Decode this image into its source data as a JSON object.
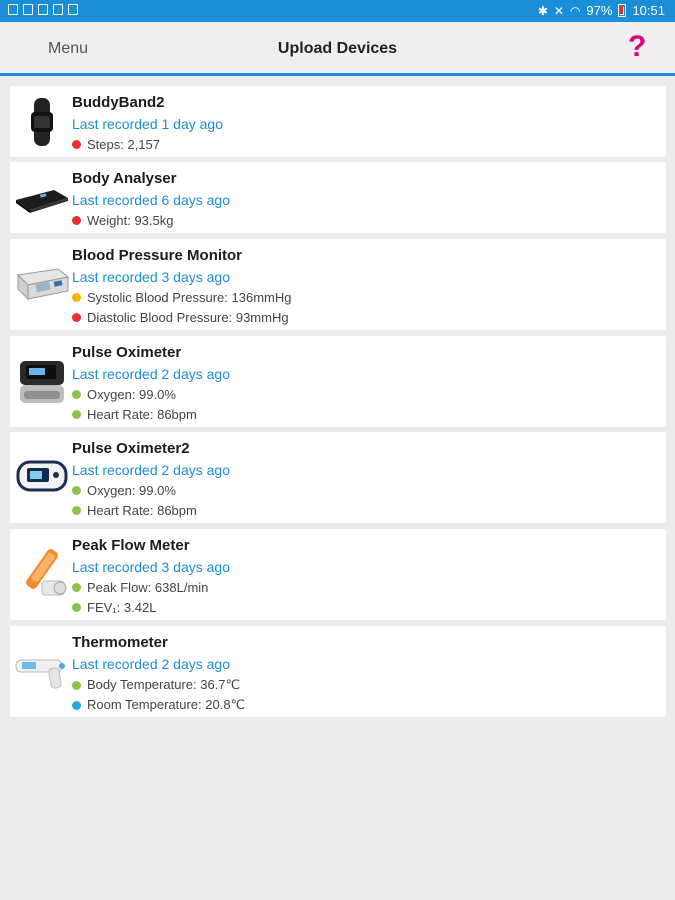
{
  "status_bar": {
    "battery_text": "97%",
    "time": "10:51"
  },
  "header": {
    "menu_label": "Menu",
    "title": "Upload Devices",
    "help_label": "?"
  },
  "colors": {
    "accent": "#1a8fd8",
    "help": "#e0007a",
    "status_red": "#e8312e",
    "status_amber": "#f4b400",
    "status_green": "#8bc34a",
    "status_blue": "#29a8e0"
  },
  "devices": [
    {
      "name": "BuddyBand2",
      "last_recorded": "Last recorded 1 day ago",
      "icon": "fitness-band-icon",
      "readings": [
        {
          "label": "Steps: 2,157",
          "status": "red"
        }
      ]
    },
    {
      "name": "Body Analyser",
      "last_recorded": "Last recorded 6 days ago",
      "icon": "body-scale-icon",
      "readings": [
        {
          "label": "Weight: 93.5kg",
          "status": "red"
        }
      ]
    },
    {
      "name": "Blood Pressure Monitor",
      "last_recorded": "Last recorded 3 days ago",
      "icon": "blood-pressure-monitor-icon",
      "readings": [
        {
          "label": "Systolic Blood Pressure: 136mmHg",
          "status": "amber"
        },
        {
          "label": "Diastolic Blood Pressure: 93mmHg",
          "status": "red"
        }
      ]
    },
    {
      "name": "Pulse Oximeter",
      "last_recorded": "Last recorded 2 days ago",
      "icon": "pulse-oximeter-icon",
      "readings": [
        {
          "label": "Oxygen: 99.0%",
          "status": "green"
        },
        {
          "label": "Heart Rate: 86bpm",
          "status": "green"
        }
      ]
    },
    {
      "name": "Pulse Oximeter2",
      "last_recorded": "Last recorded 2 days ago",
      "icon": "pulse-oximeter-icon",
      "readings": [
        {
          "label": "Oxygen: 99.0%",
          "status": "green"
        },
        {
          "label": "Heart Rate: 86bpm",
          "status": "green"
        }
      ]
    },
    {
      "name": "Peak Flow Meter",
      "last_recorded": "Last recorded 3 days ago",
      "icon": "peak-flow-meter-icon",
      "readings": [
        {
          "label": "Peak Flow: 638L/min",
          "status": "green"
        },
        {
          "label": "FEV₁: 3.42L",
          "status": "green"
        }
      ]
    },
    {
      "name": "Thermometer",
      "last_recorded": "Last recorded 2 days ago",
      "icon": "thermometer-icon",
      "readings": [
        {
          "label": "Body Temperature: 36.7℃",
          "status": "green"
        },
        {
          "label": "Room Temperature: 20.8℃",
          "status": "blue"
        }
      ]
    }
  ]
}
